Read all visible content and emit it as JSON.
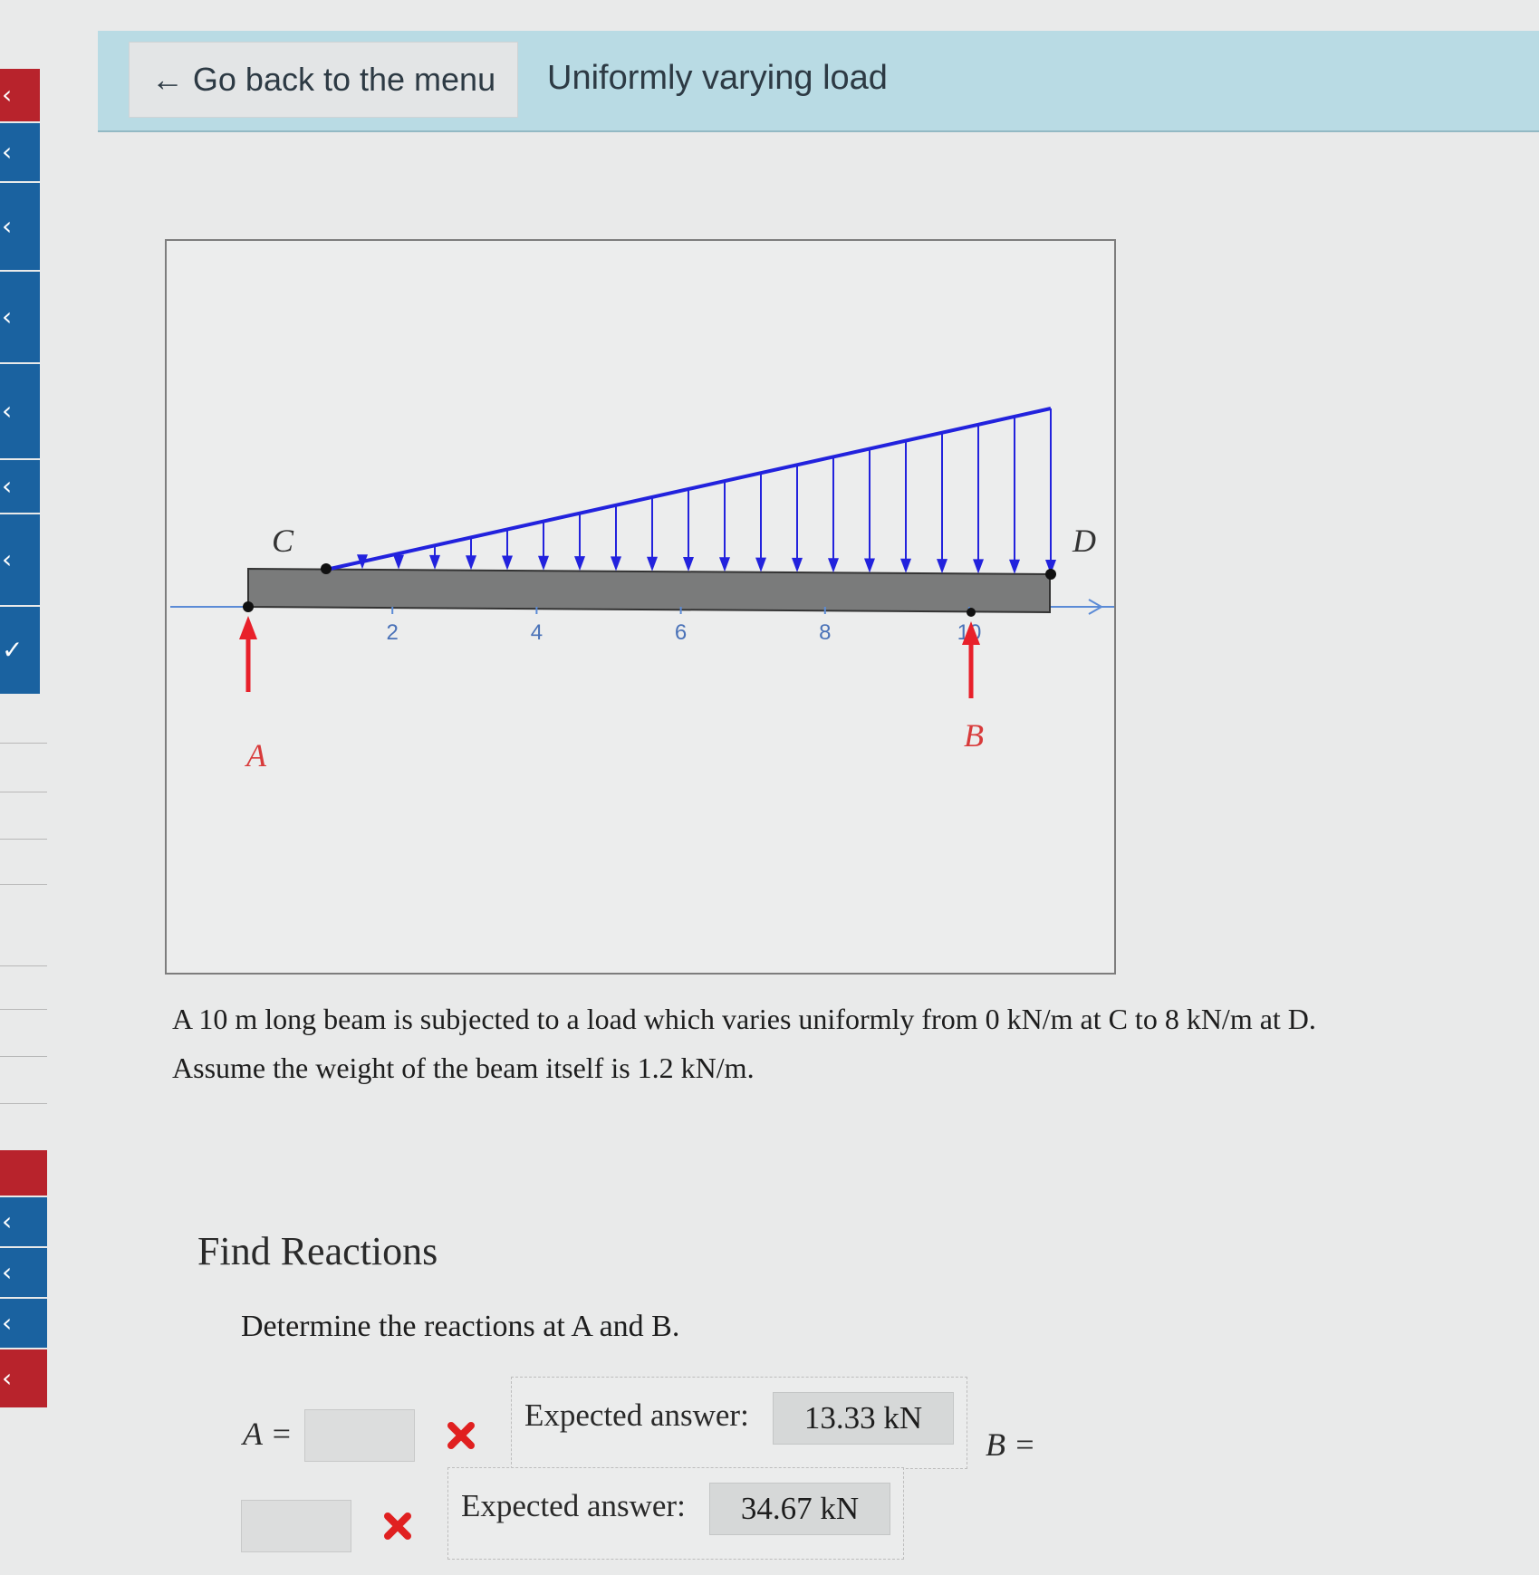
{
  "header": {
    "back_button_label": "← Go back to the menu",
    "page_title": "Uniformly varying load"
  },
  "figure": {
    "point_labels": {
      "A": "A",
      "B": "B",
      "C": "C",
      "D": "D"
    },
    "axis_ticks": [
      "2",
      "4",
      "6",
      "8",
      "10"
    ],
    "colors": {
      "load_arrows": "#2222dd",
      "reactions": "#e8202a",
      "beam": "#7a7b7b",
      "axis": "#5b8bd6"
    }
  },
  "problem": {
    "line1": "A 10 m long beam is subjected to a load which varies uniformly from 0 kN/m at C to 8 kN/m at D.",
    "line2": "Assume the weight of the beam itself is 1.2 kN/m."
  },
  "section": {
    "title": "Find Reactions",
    "question": "Determine the reactions at A and B."
  },
  "answers": {
    "a": {
      "label": "A =",
      "expected_label": "Expected answer:",
      "expected_value": "13.33 kN"
    },
    "b": {
      "label": "B =",
      "expected_label": "Expected answer:",
      "expected_value": "34.67 kN"
    }
  }
}
